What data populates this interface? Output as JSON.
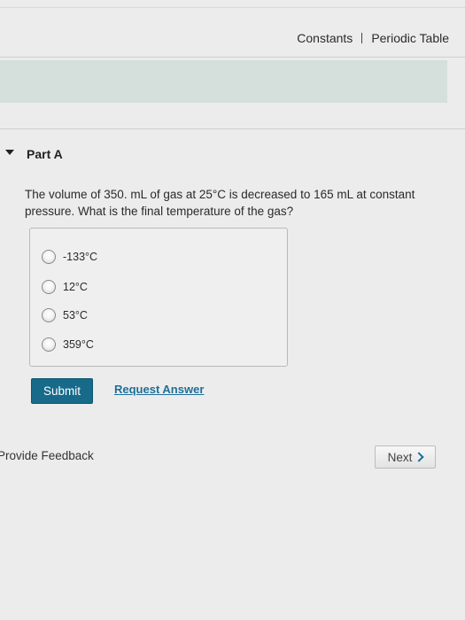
{
  "header": {
    "links": [
      "Constants",
      "Periodic Table"
    ]
  },
  "part": {
    "title": "Part A"
  },
  "question": {
    "text": "The volume of 350. mL of gas at 25°C is decreased to 165 mL at constant pressure. What is the final temperature of the gas?"
  },
  "options": [
    {
      "label": "-133°C",
      "selected": false
    },
    {
      "label": "12°C",
      "selected": false
    },
    {
      "label": "53°C",
      "selected": false
    },
    {
      "label": "359°C",
      "selected": false
    }
  ],
  "actions": {
    "submit_label": "Submit",
    "request_answer_label": "Request Answer"
  },
  "footer": {
    "feedback_label": "Provide Feedback",
    "next_label": "Next"
  },
  "colors": {
    "submit_button": "#176a8a",
    "link": "#1e6f99",
    "banner": "#d5dfdc"
  }
}
